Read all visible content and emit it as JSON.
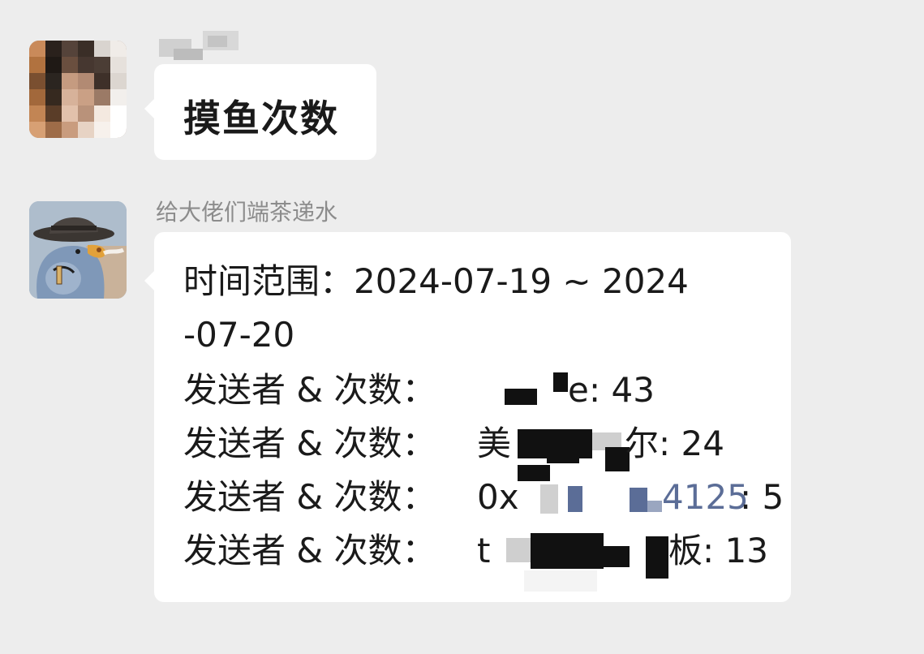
{
  "chat": {
    "messages": [
      {
        "sender_name": "",
        "text": "摸鱼次数"
      },
      {
        "sender_name": "给大佬们端茶递水",
        "time_range_line1": "时间范围：2024-07-19 ~ 2024",
        "time_range_line2": "-07-20",
        "rows": [
          {
            "label": "发送者 & 次数：",
            "name_start": "",
            "name_end": "e",
            "sep": ": ",
            "count": "43"
          },
          {
            "label": "发送者 & 次数：",
            "name_start": "美",
            "name_end": "尔",
            "sep": ": ",
            "count": "24"
          },
          {
            "label": "发送者 & 次数：",
            "name_start": "0x",
            "name_end": "4125",
            "sep": ": ",
            "count": "5"
          },
          {
            "label": "发送者 & 次数：",
            "name_start": "t",
            "name_end": "板",
            "sep": ": ",
            "count": "13"
          }
        ]
      }
    ]
  },
  "colors": {
    "background": "#ededed",
    "bubble": "#ffffff",
    "sender_name": "#8c8c8c",
    "text": "#1a1a1a",
    "link": "#5b6d97"
  }
}
